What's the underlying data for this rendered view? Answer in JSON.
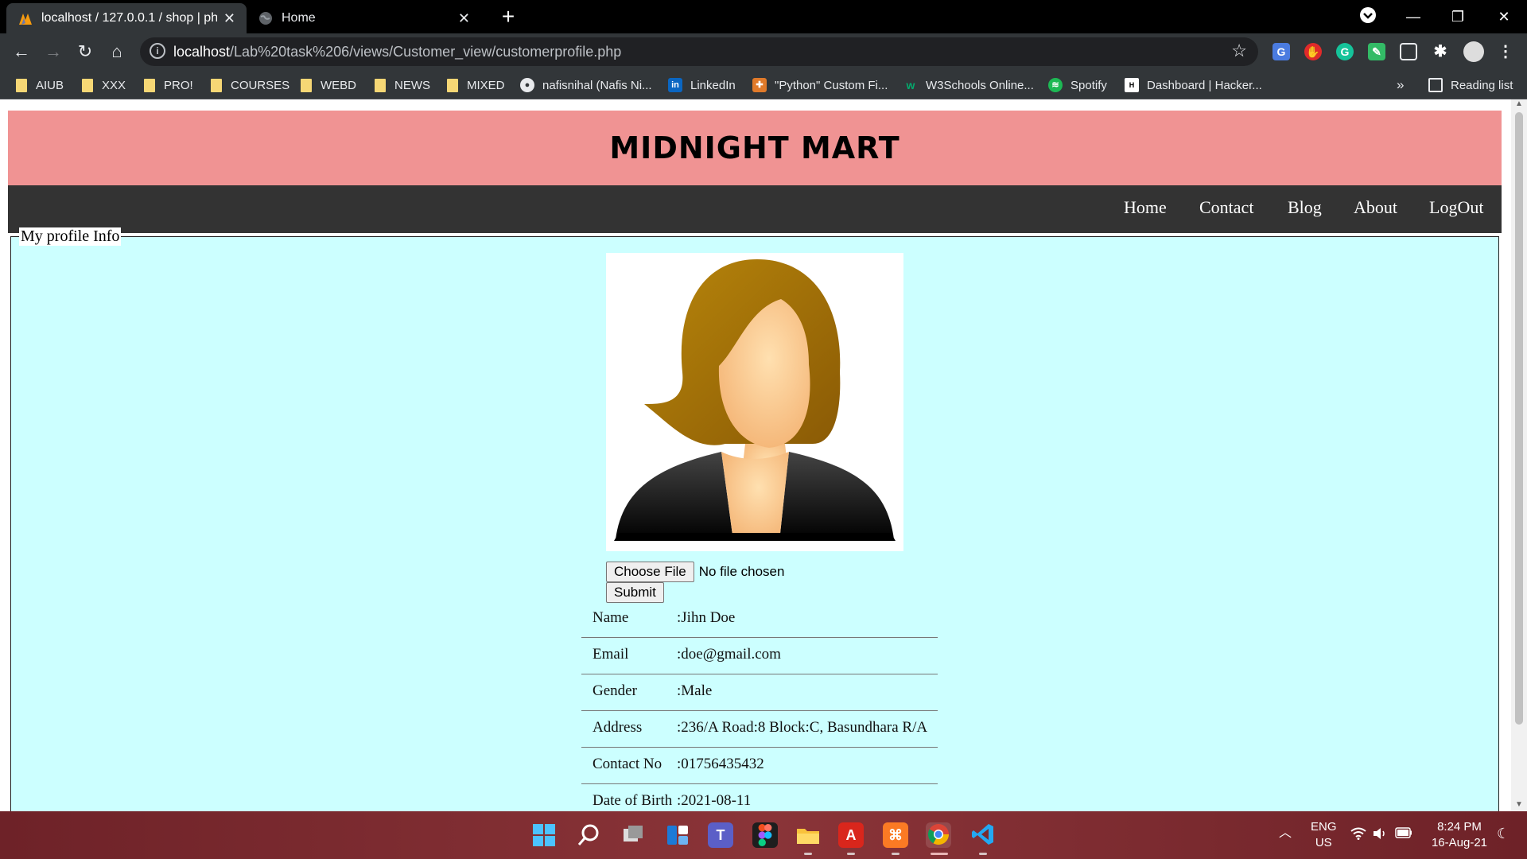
{
  "browser": {
    "tabs": [
      {
        "title": "localhost / 127.0.0.1 / shop | php",
        "active": true,
        "icon": "phpmyadmin-icon"
      },
      {
        "title": "Home",
        "active": false,
        "icon": "globe-icon"
      }
    ],
    "address": {
      "host": "localhost",
      "path": "/Lab%20task%206/views/Customer_view/customerprofile.php"
    },
    "bookmarks": [
      {
        "label": "AIUB",
        "icon": "folder-icon"
      },
      {
        "label": "XXX",
        "icon": "folder-icon"
      },
      {
        "label": "PRO!",
        "icon": "folder-icon"
      },
      {
        "label": "COURSES",
        "icon": "folder-icon"
      },
      {
        "label": "WEBD",
        "icon": "folder-icon"
      },
      {
        "label": "NEWS",
        "icon": "folder-icon"
      },
      {
        "label": "MIXED",
        "icon": "folder-icon"
      },
      {
        "label": "nafisnihal (Nafis Ni...",
        "icon": "github-icon"
      },
      {
        "label": "LinkedIn",
        "icon": "linkedin-icon"
      },
      {
        "label": "\"Python\" Custom Fi...",
        "icon": "python-icon"
      },
      {
        "label": "W3Schools Online...",
        "icon": "w3schools-icon"
      },
      {
        "label": "Spotify",
        "icon": "spotify-icon"
      },
      {
        "label": "Dashboard | Hacker...",
        "icon": "hackerrank-icon"
      }
    ],
    "overflow": "»",
    "reading_list": "Reading list"
  },
  "site": {
    "title": "MIDNIGHT MART",
    "nav": [
      "Home",
      "Contact",
      "Blog",
      "About",
      "LogOut"
    ],
    "colors": {
      "header": "#f09393",
      "nav": "#333333",
      "content": "#ccffff"
    }
  },
  "profile": {
    "legend": "My profile Info",
    "file_button": "Choose File",
    "file_status": "No file chosen",
    "submit": "Submit",
    "rows": [
      {
        "label": "Name",
        "value": ":Jihn Doe"
      },
      {
        "label": "Email",
        "value": ":doe@gmail.com"
      },
      {
        "label": "Gender",
        "value": ":Male"
      },
      {
        "label": "Address",
        "value": ":236/A Road:8 Block:C, Basundhara R/A"
      },
      {
        "label": "Contact No",
        "value": ":01756435432"
      },
      {
        "label": "Date of Birth",
        "value": ":2021-08-11"
      }
    ]
  },
  "taskbar": {
    "lang_top": "ENG",
    "lang_bottom": "US",
    "time": "8:24 PM",
    "date": "16-Aug-21"
  }
}
